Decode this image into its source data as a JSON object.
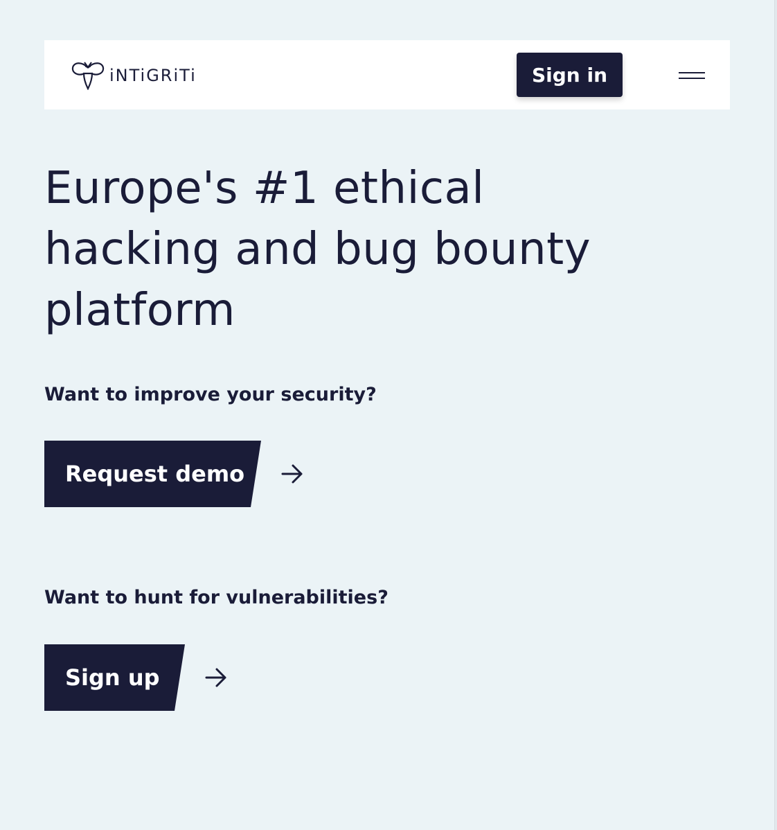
{
  "header": {
    "logo_text": "iNTiGRiTi",
    "signin_label": "Sign in"
  },
  "hero": {
    "title": "Europe's #1 ethical hacking and bug bounty platform"
  },
  "security": {
    "question": "Want to improve your security?",
    "button_label": "Request demo"
  },
  "hunt": {
    "question": "Want to hunt for vulnerabilities?",
    "button_label": "Sign up"
  },
  "colors": {
    "background": "#ebf3f6",
    "primary": "#1a1c38",
    "header_bg": "#ffffff"
  },
  "icons": [
    "logo-mark-icon",
    "hamburger-menu-icon",
    "arrow-right-icon"
  ]
}
